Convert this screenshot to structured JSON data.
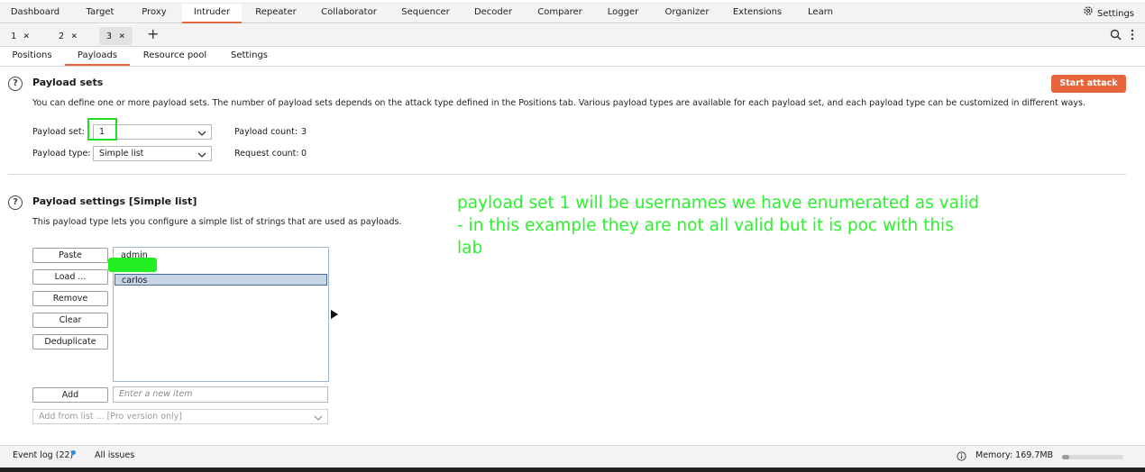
{
  "main_tabs": [
    "Dashboard",
    "Target",
    "Proxy",
    "Intruder",
    "Repeater",
    "Collaborator",
    "Sequencer",
    "Decoder",
    "Comparer",
    "Logger",
    "Organizer",
    "Extensions",
    "Learn"
  ],
  "active_main_tab": "Intruder",
  "settings_label": "Settings",
  "attack_tabs": [
    {
      "label": "1",
      "close": "×"
    },
    {
      "label": "2",
      "close": "×"
    },
    {
      "label": "3",
      "close": "×"
    }
  ],
  "add_tab_glyph": "+",
  "panel_tabs": [
    "Positions",
    "Payloads",
    "Resource pool",
    "Settings"
  ],
  "active_panel_tab": "Payloads",
  "payload_sets": {
    "title": "Payload sets",
    "description": "You can define one or more payload sets. The number of payload sets depends on the attack type defined in the Positions tab. Various payload types are available for each payload set, and each payload type can be customized in different ways.",
    "set_label": "Payload set:",
    "set_value": "1",
    "type_label": "Payload type:",
    "type_value": "Simple list",
    "payload_count_label": "Payload count:",
    "payload_count": "3",
    "request_count_label": "Request count:",
    "request_count": "0",
    "start_attack": "Start attack"
  },
  "payload_settings": {
    "title": "Payload settings [Simple list]",
    "description": "This payload type lets you configure a simple list of strings that are used as payloads.",
    "buttons": {
      "paste": "Paste",
      "load": "Load ...",
      "remove": "Remove",
      "clear": "Clear",
      "dedup": "Deduplicate",
      "add": "Add"
    },
    "items": [
      "admin",
      "",
      "carlos"
    ],
    "add_placeholder": "Enter a new item",
    "add_from_list": "Add from list ... [Pro version only]"
  },
  "annotation": {
    "line1": "payload set 1 will be usernames we have enumerated as valid",
    "line2": "- in this example they are not all valid but it is poc with this",
    "line3": "lab"
  },
  "status": {
    "event_log": "Event log (22)",
    "all_issues": "All issues",
    "memory": "Memory: 169.7MB",
    "memory_fraction": 0.12
  },
  "colors": {
    "accent": "#e8643c",
    "annotation": "#2ef02e",
    "highlight_box": "#22dd22"
  },
  "icons": [
    "gear-icon",
    "search-icon",
    "kebab-menu-icon",
    "help-icon",
    "chevron-down-icon",
    "info-icon",
    "cursor-icon"
  ]
}
